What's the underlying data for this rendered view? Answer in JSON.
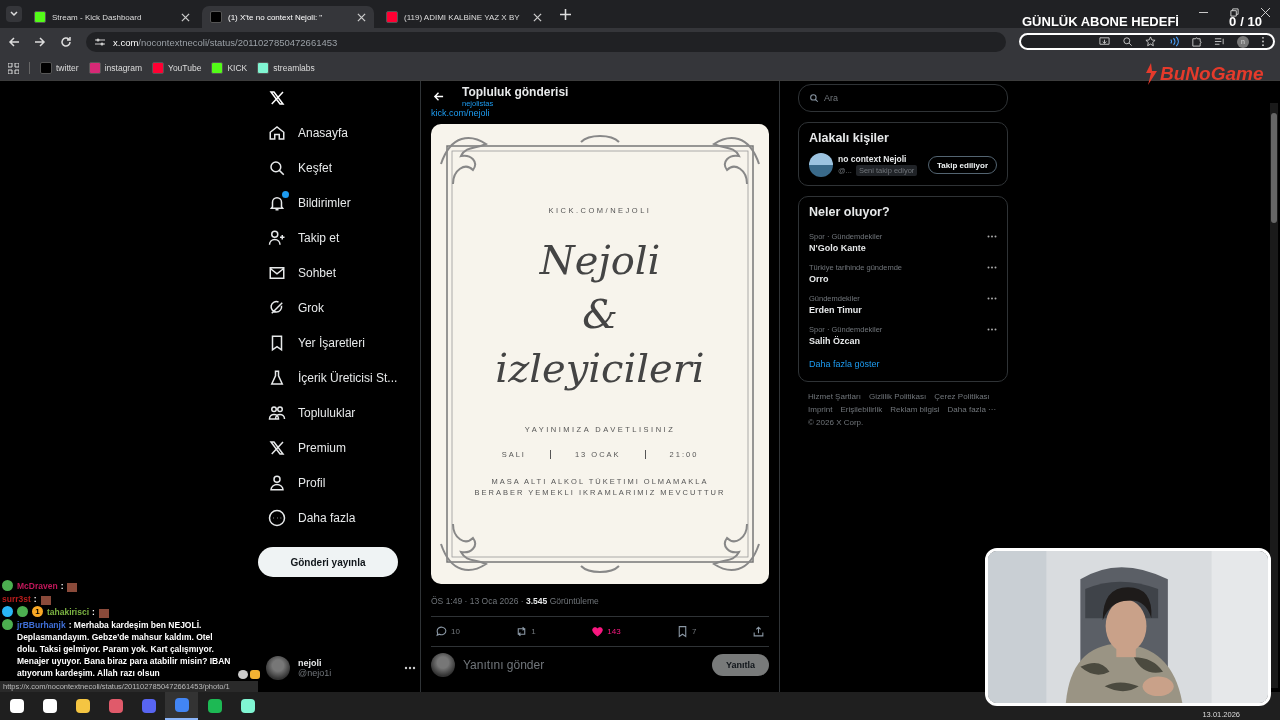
{
  "tabs": [
    {
      "title": "Stream - Kick Dashboard",
      "kind": "kick",
      "selected": false
    },
    {
      "title": "(1) X'te no context Nejoli: \"",
      "kind": "x",
      "selected": true
    },
    {
      "title": "(119) ADIMI KALBİNE YAZ X BY",
      "kind": "youtube",
      "selected": false
    }
  ],
  "address": {
    "host": "x.com",
    "path": "/nocontextnecoli/status/2011027850472661453"
  },
  "bookmarks": [
    {
      "label": "twitter",
      "kind": "x"
    },
    {
      "label": "instagram",
      "kind": "instagram"
    },
    {
      "label": "YouTube",
      "kind": "youtube"
    },
    {
      "label": "KICK",
      "kind": "kick"
    },
    {
      "label": "streamlabs",
      "kind": "streamlabs"
    }
  ],
  "profile_initial": "n",
  "overlay": {
    "goal_title": "GÜNLÜK ABONE HEDEFİ",
    "goal_count": "0",
    "goal_total": "/ 10",
    "logo": "BuNoGame"
  },
  "nav": [
    {
      "label": "Anasayfa",
      "kind": "home",
      "badge": false
    },
    {
      "label": "Keşfet",
      "kind": "search",
      "badge": false
    },
    {
      "label": "Bildirimler",
      "kind": "bell",
      "badge": true
    },
    {
      "label": "Takip et",
      "kind": "follow",
      "badge": false
    },
    {
      "label": "Sohbet",
      "kind": "mail",
      "badge": false
    },
    {
      "label": "Grok",
      "kind": "grok",
      "badge": false
    },
    {
      "label": "Yer İşaretleri",
      "kind": "bookmark",
      "badge": false
    },
    {
      "label": "İçerik Üreticisi St...",
      "kind": "creator",
      "badge": false
    },
    {
      "label": "Topluluklar",
      "kind": "communities",
      "badge": false
    },
    {
      "label": "Premium",
      "kind": "x",
      "badge": false
    },
    {
      "label": "Profil",
      "kind": "profile",
      "badge": false
    },
    {
      "label": "Daha fazla",
      "kind": "more",
      "badge": false
    }
  ],
  "post_button": "Gönderi yayınla",
  "account": {
    "name": "nejoli",
    "handle": "@nejo1i"
  },
  "post": {
    "header": "Topluluk gönderisi",
    "community": "nejolistas",
    "link": "kick.com/nejoli",
    "card": {
      "site": "KICK.COM/NEJOLI",
      "script_lines": [
        "Nejoli",
        "&",
        "izleyicileri"
      ],
      "invite": "YAYINIMIZA DAVETLISINIZ",
      "when": [
        "SALI",
        "13 OCAK",
        "21:00"
      ],
      "note_lines": [
        "MASA ALTI ALKOL TÜKETIMI OLMAMAKLA",
        "BERABER YEMEKLI IKRAMLARIMIZ MEVCUTTUR"
      ]
    },
    "meta": "ÖS 1:49 · 13 Oca 2026 · **3.545** Görüntüleme",
    "actions": [
      {
        "kind": "reply",
        "count": "10",
        "active": false
      },
      {
        "kind": "repost",
        "count": "1",
        "active": false
      },
      {
        "kind": "like",
        "count": "143",
        "active": true
      },
      {
        "kind": "bookmark",
        "count": "7",
        "active": false
      },
      {
        "kind": "share",
        "active": false
      }
    ],
    "reply_placeholder": "Yanıtını gönder",
    "reply_button": "Yanıtla"
  },
  "search": {
    "placeholder": "Ara"
  },
  "related": {
    "title": "Alakalı kişiler",
    "name": "no context Nejoli",
    "handle": "@...",
    "follows_you": "Seni takip ediyor",
    "button": "Takip ediliyor"
  },
  "trends": {
    "title": "Neler oluyor?",
    "items": [
      {
        "context": "Spor · Gündemdekiler",
        "name": "N'Golo Kante"
      },
      {
        "context": "Türkiye tarihinde gündemde",
        "name": "Orro"
      },
      {
        "context": "Gündemdekiler",
        "name": "Erden Timur"
      },
      {
        "context": "Spor · Gündemdekiler",
        "name": "Salih Özcan"
      }
    ],
    "more": "Daha fazla göster"
  },
  "footer_links": [
    "Hizmet Şartları",
    "Gizlilik Politikası",
    "Çerez Politikası",
    "Imprint",
    "Erişilebilirlik",
    "Reklam bilgisi",
    "Daha fazla ···"
  ],
  "copyright": "© 2026 X Corp.",
  "chat": [
    {
      "user": "McDraven",
      "color": "#c2185b",
      "badges": [
        {
          "kind": "plus"
        }
      ],
      "text": ":",
      "emotes": [
        {
          "kind": "sticker"
        }
      ]
    },
    {
      "user": "surr3st",
      "color": "#b71c1c",
      "text": ":",
      "emotes": [
        {
          "kind": "sticker"
        }
      ]
    },
    {
      "user": "tahakirisci",
      "color": "#7cb342",
      "badges": [
        {
          "kind": "gem"
        },
        {
          "kind": "plus"
        },
        {
          "kind": "coin",
          "label": "1"
        }
      ],
      "text": ":",
      "emotes": [
        {
          "kind": "sticker"
        }
      ]
    },
    {
      "user": "jrBBurhanjk",
      "color": "#3f6fd8",
      "badges": [
        {
          "kind": "plus"
        }
      ],
      "text": ": Merhaba kardeşim ben NEJOLİ. Deplasmandayım. Gebze'de mahsur kaldım. Otel dolu. Taksi gelmiyor. Param yok. Kart çalışmıyor. Menajer uyuyor. Bana biraz para atabilir misin? IBAN atıyorum kardeşim. Allah razı olsun",
      "emotes": [
        {
          "kind": "gear"
        },
        {
          "kind": "pray"
        }
      ]
    }
  ],
  "status_url": "https://x.com/nocontextnecoli/status/2011027850472661453/photo/1",
  "taskbar": {
    "apps": [
      {
        "kind": "start",
        "active": false
      },
      {
        "kind": "search",
        "active": false
      },
      {
        "kind": "files",
        "active": false
      },
      {
        "kind": "tool",
        "active": false
      },
      {
        "kind": "discord",
        "active": false
      },
      {
        "kind": "chrome",
        "active": true
      },
      {
        "kind": "spotify",
        "active": false
      },
      {
        "kind": "streamlabs",
        "active": false
      }
    ],
    "date": "13.01.2026"
  }
}
